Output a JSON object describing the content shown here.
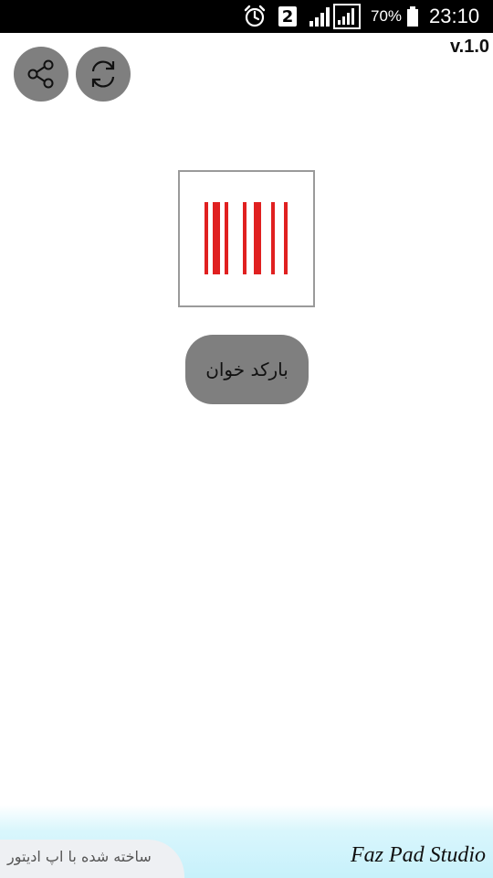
{
  "status_bar": {
    "icons": {
      "alarm": "alarm-clock-icon",
      "sim": "sim-2-icon",
      "signal_1": "signal-bars-icon",
      "signal_2": "signal-bars-boxed-icon",
      "battery": "battery-icon"
    },
    "sim_number": "2",
    "battery_percent": "70%",
    "time": "23:10"
  },
  "header": {
    "version": "v.1.0",
    "share_icon": "share-icon",
    "refresh_icon": "refresh-icon"
  },
  "main": {
    "barcode_image": "barcode-icon",
    "barcode_color": "#e02020",
    "scan_button_label": "بارکد خوان"
  },
  "footer": {
    "made_with": "ساخته شده با اپ ادیتور",
    "studio": "Faz Pad Studio"
  },
  "colors": {
    "button_gray": "#7f7f7f",
    "footer_cyan": "#c7f1fb"
  }
}
